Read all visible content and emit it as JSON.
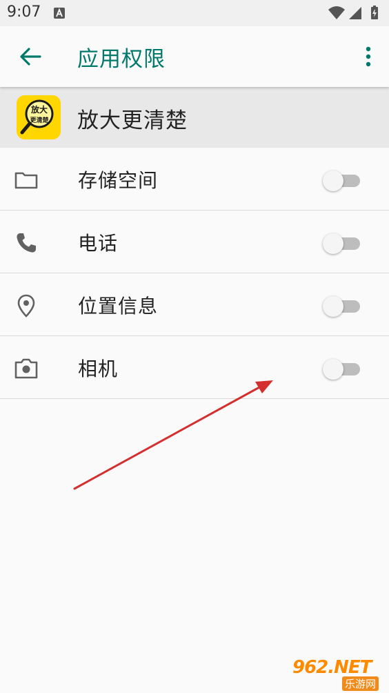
{
  "status_bar": {
    "time": "9:07"
  },
  "app_bar": {
    "title": "应用权限"
  },
  "app_header": {
    "name": "放大更清楚",
    "icon_text_line1": "放大",
    "icon_text_line2": "更清楚",
    "icon_color": "#ffd600"
  },
  "permissions": [
    {
      "label": "存储空间",
      "icon": "folder-icon",
      "enabled": false
    },
    {
      "label": "电话",
      "icon": "phone-icon",
      "enabled": false
    },
    {
      "label": "位置信息",
      "icon": "location-icon",
      "enabled": false
    },
    {
      "label": "相机",
      "icon": "camera-icon",
      "enabled": false
    }
  ],
  "watermark": {
    "main": "962.NET",
    "sub": "乐游网"
  },
  "colors": {
    "accent": "#00796b",
    "arrow": "#d32f2f",
    "toggle_track_off": "#bdbdbd"
  }
}
